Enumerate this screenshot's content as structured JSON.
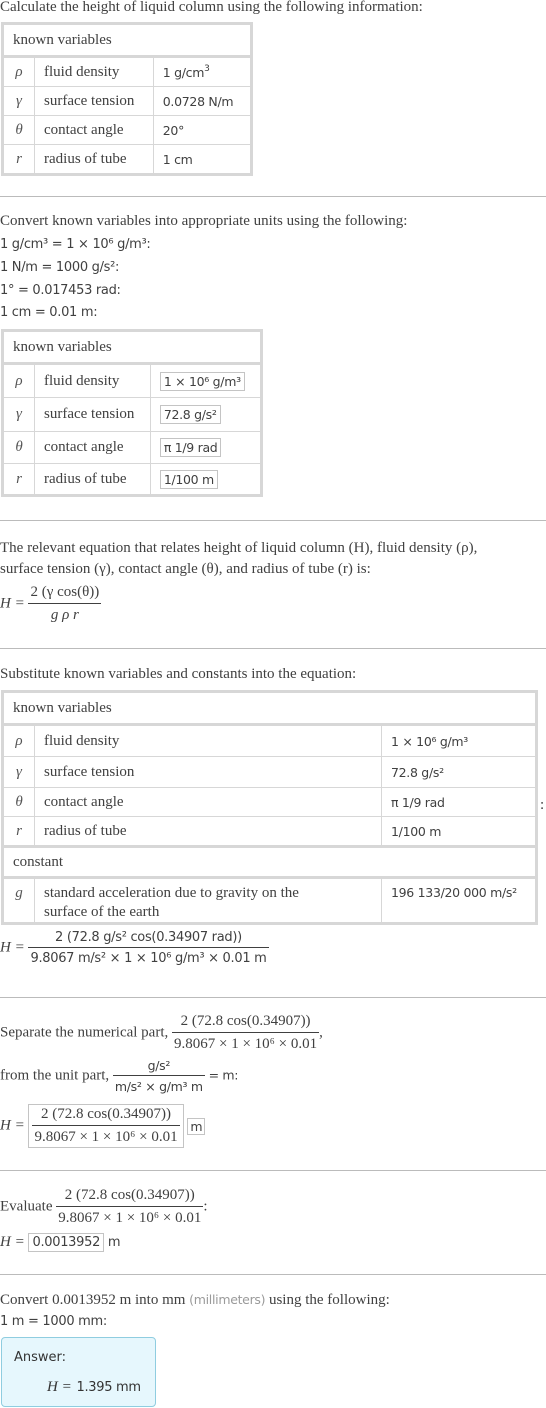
{
  "intro": "Calculate the height of liquid column using the following information:",
  "table1": {
    "header": "known variables",
    "rows": [
      {
        "symbol": "ρ",
        "name": "fluid density",
        "value": "1 g/cm",
        "exp": "3"
      },
      {
        "symbol": "γ",
        "name": "surface tension",
        "value": "0.0728 N/m",
        "exp": ""
      },
      {
        "symbol": "θ",
        "name": "contact angle",
        "value": "20°",
        "exp": ""
      },
      {
        "symbol": "r",
        "name": "radius of tube",
        "value": "1 cm",
        "exp": ""
      }
    ]
  },
  "convert": {
    "text": "Convert known variables into appropriate units using the following:",
    "lines": [
      "1 g/cm³ = 1 × 10⁶ g/m³:",
      "1 N/m = 1000 g/s²:",
      "1° = 0.017453 rad:",
      "1 cm = 0.01 m:"
    ]
  },
  "table2": {
    "header": "known variables",
    "rows": [
      {
        "symbol": "ρ",
        "name": "fluid density",
        "value": "1 × 10⁶ g/m³"
      },
      {
        "symbol": "γ",
        "name": "surface tension",
        "value": "72.8 g/s²"
      },
      {
        "symbol": "θ",
        "name": "contact angle",
        "value": "π 1/9 rad"
      },
      {
        "symbol": "r",
        "name": "radius of tube",
        "value": "1/100 m"
      }
    ]
  },
  "equation": {
    "text1": "The relevant equation that relates height of liquid column (H), fluid density (ρ),",
    "text2": "surface tension (γ), contact angle (θ), and radius of tube (r) is:",
    "lhs": "H =",
    "numerator": "2 (γ cos(θ))",
    "denominator": "g ρ r"
  },
  "substitute": {
    "text": "Substitute known variables and constants into the equation:",
    "known_header": "known variables",
    "rows": [
      {
        "symbol": "ρ",
        "name": "fluid density",
        "value": "1 × 10⁶ g/m³"
      },
      {
        "symbol": "γ",
        "name": "surface tension",
        "value": "72.8 g/s²"
      },
      {
        "symbol": "θ",
        "name": "contact angle",
        "value": "π 1/9 rad"
      },
      {
        "symbol": "r",
        "name": "radius of tube",
        "value": "1/100 m"
      }
    ],
    "constant_header": "constant",
    "constant": {
      "symbol": "g",
      "name_line1": "standard acceleration due to gravity on the",
      "name_line2": "surface of the earth",
      "value": "196 133/20 000 m/s²"
    },
    "colon": ":",
    "lhs": "H =",
    "numerator": "2 (72.8 g/s² cos(0.34907 rad))",
    "denominator": "9.8067 m/s² × 1 × 10⁶ g/m³ × 0.01 m"
  },
  "separate": {
    "text1": "Separate the numerical part,",
    "num_numerator": "2 (72.8 cos(0.34907))",
    "num_denominator": "9.8067 × 1 × 10⁶ × 0.01",
    "comma": ",",
    "text2": "from the unit part,",
    "unit_numerator": "g/s²",
    "unit_denominator": "m/s² × g/m³ m",
    "unit_result": "= m:",
    "lhs": "H =",
    "boxed_numerator": "2 (72.8 cos(0.34907))",
    "boxed_denominator": "9.8067 × 1 × 10⁶ × 0.01",
    "boxed_unit": "m"
  },
  "evaluate": {
    "text": "Evaluate",
    "numerator": "2 (72.8 cos(0.34907))",
    "denominator": "9.8067 × 1 × 10⁶ × 0.01",
    "colon": ":",
    "lhs": "H =",
    "value": "0.0013952",
    "unit": "m"
  },
  "final": {
    "text_a": "Convert 0.0013952 m into mm",
    "text_b": "(millimeters)",
    "text_c": "using the following:",
    "rule": "1 m = 1000 mm:",
    "answer_label": "Answer:",
    "answer_lhs": "H =",
    "answer_value": "1.395 mm"
  }
}
